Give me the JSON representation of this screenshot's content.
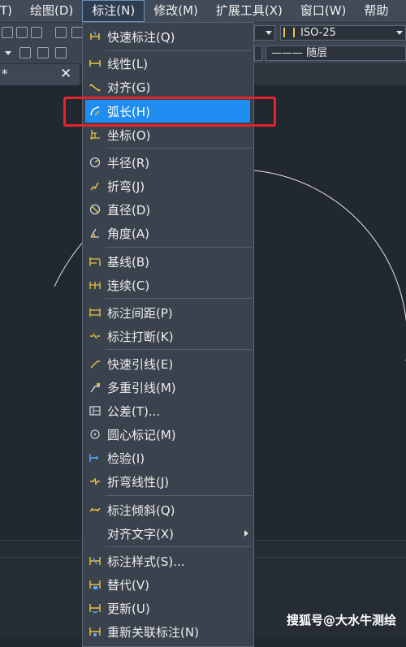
{
  "menubar": {
    "items": [
      {
        "label": "T)"
      },
      {
        "label": "绘图(D)"
      },
      {
        "label": "标注(N)"
      },
      {
        "label": "修改(M)"
      },
      {
        "label": "扩展工具(X)"
      },
      {
        "label": "窗口(W)"
      },
      {
        "label": "帮助"
      }
    ]
  },
  "toolbar": {
    "dimstyle_value": "ISO-25",
    "linetype_value": "——— 随层"
  },
  "drawing_tab": {
    "modified_mark": "*",
    "close_glyph": "✕"
  },
  "menu": {
    "items": [
      {
        "label": "快速标注(Q)",
        "icon": "quick-dimension-icon"
      },
      {
        "label": "线性(L)",
        "icon": "linear-dimension-icon"
      },
      {
        "label": "对齐(G)",
        "icon": "aligned-dimension-icon"
      },
      {
        "label": "弧长(H)",
        "icon": "arc-length-icon"
      },
      {
        "label": "坐标(O)",
        "icon": "ordinate-icon"
      },
      {
        "label": "半径(R)",
        "icon": "radius-icon"
      },
      {
        "label": "折弯(J)",
        "icon": "jogged-icon"
      },
      {
        "label": "直径(D)",
        "icon": "diameter-icon"
      },
      {
        "label": "角度(A)",
        "icon": "angular-icon"
      },
      {
        "label": "基线(B)",
        "icon": "baseline-icon"
      },
      {
        "label": "连续(C)",
        "icon": "continue-icon"
      },
      {
        "label": "标注间距(P)",
        "icon": "dimension-space-icon"
      },
      {
        "label": "标注打断(K)",
        "icon": "dimension-break-icon"
      },
      {
        "label": "快速引线(E)",
        "icon": "quick-leader-icon"
      },
      {
        "label": "多重引线(M)",
        "icon": "multileader-icon"
      },
      {
        "label": "公差(T)...",
        "icon": "tolerance-icon"
      },
      {
        "label": "圆心标记(M)",
        "icon": "center-mark-icon"
      },
      {
        "label": "检验(I)",
        "icon": "inspection-icon"
      },
      {
        "label": "折弯线性(J)",
        "icon": "jogged-linear-icon"
      },
      {
        "label": "标注倾斜(Q)",
        "icon": "oblique-icon"
      },
      {
        "label": "对齐文字(X)",
        "icon": ""
      },
      {
        "label": "标注样式(S)...",
        "icon": "dimension-style-icon"
      },
      {
        "label": "替代(V)",
        "icon": "override-icon"
      },
      {
        "label": "更新(U)",
        "icon": "update-icon"
      },
      {
        "label": "重新关联标注(N)",
        "icon": "reassociate-icon"
      }
    ],
    "highlighted_index": 3
  },
  "annotation": {
    "highlight_color": "#e8232a"
  },
  "watermark": {
    "text": "搜狐号@大水牛测绘"
  },
  "colors": {
    "background": "#212830",
    "menu_bg": "#3a424d",
    "highlight": "#1e8cf0",
    "icon_yellow": "#e8c341"
  }
}
